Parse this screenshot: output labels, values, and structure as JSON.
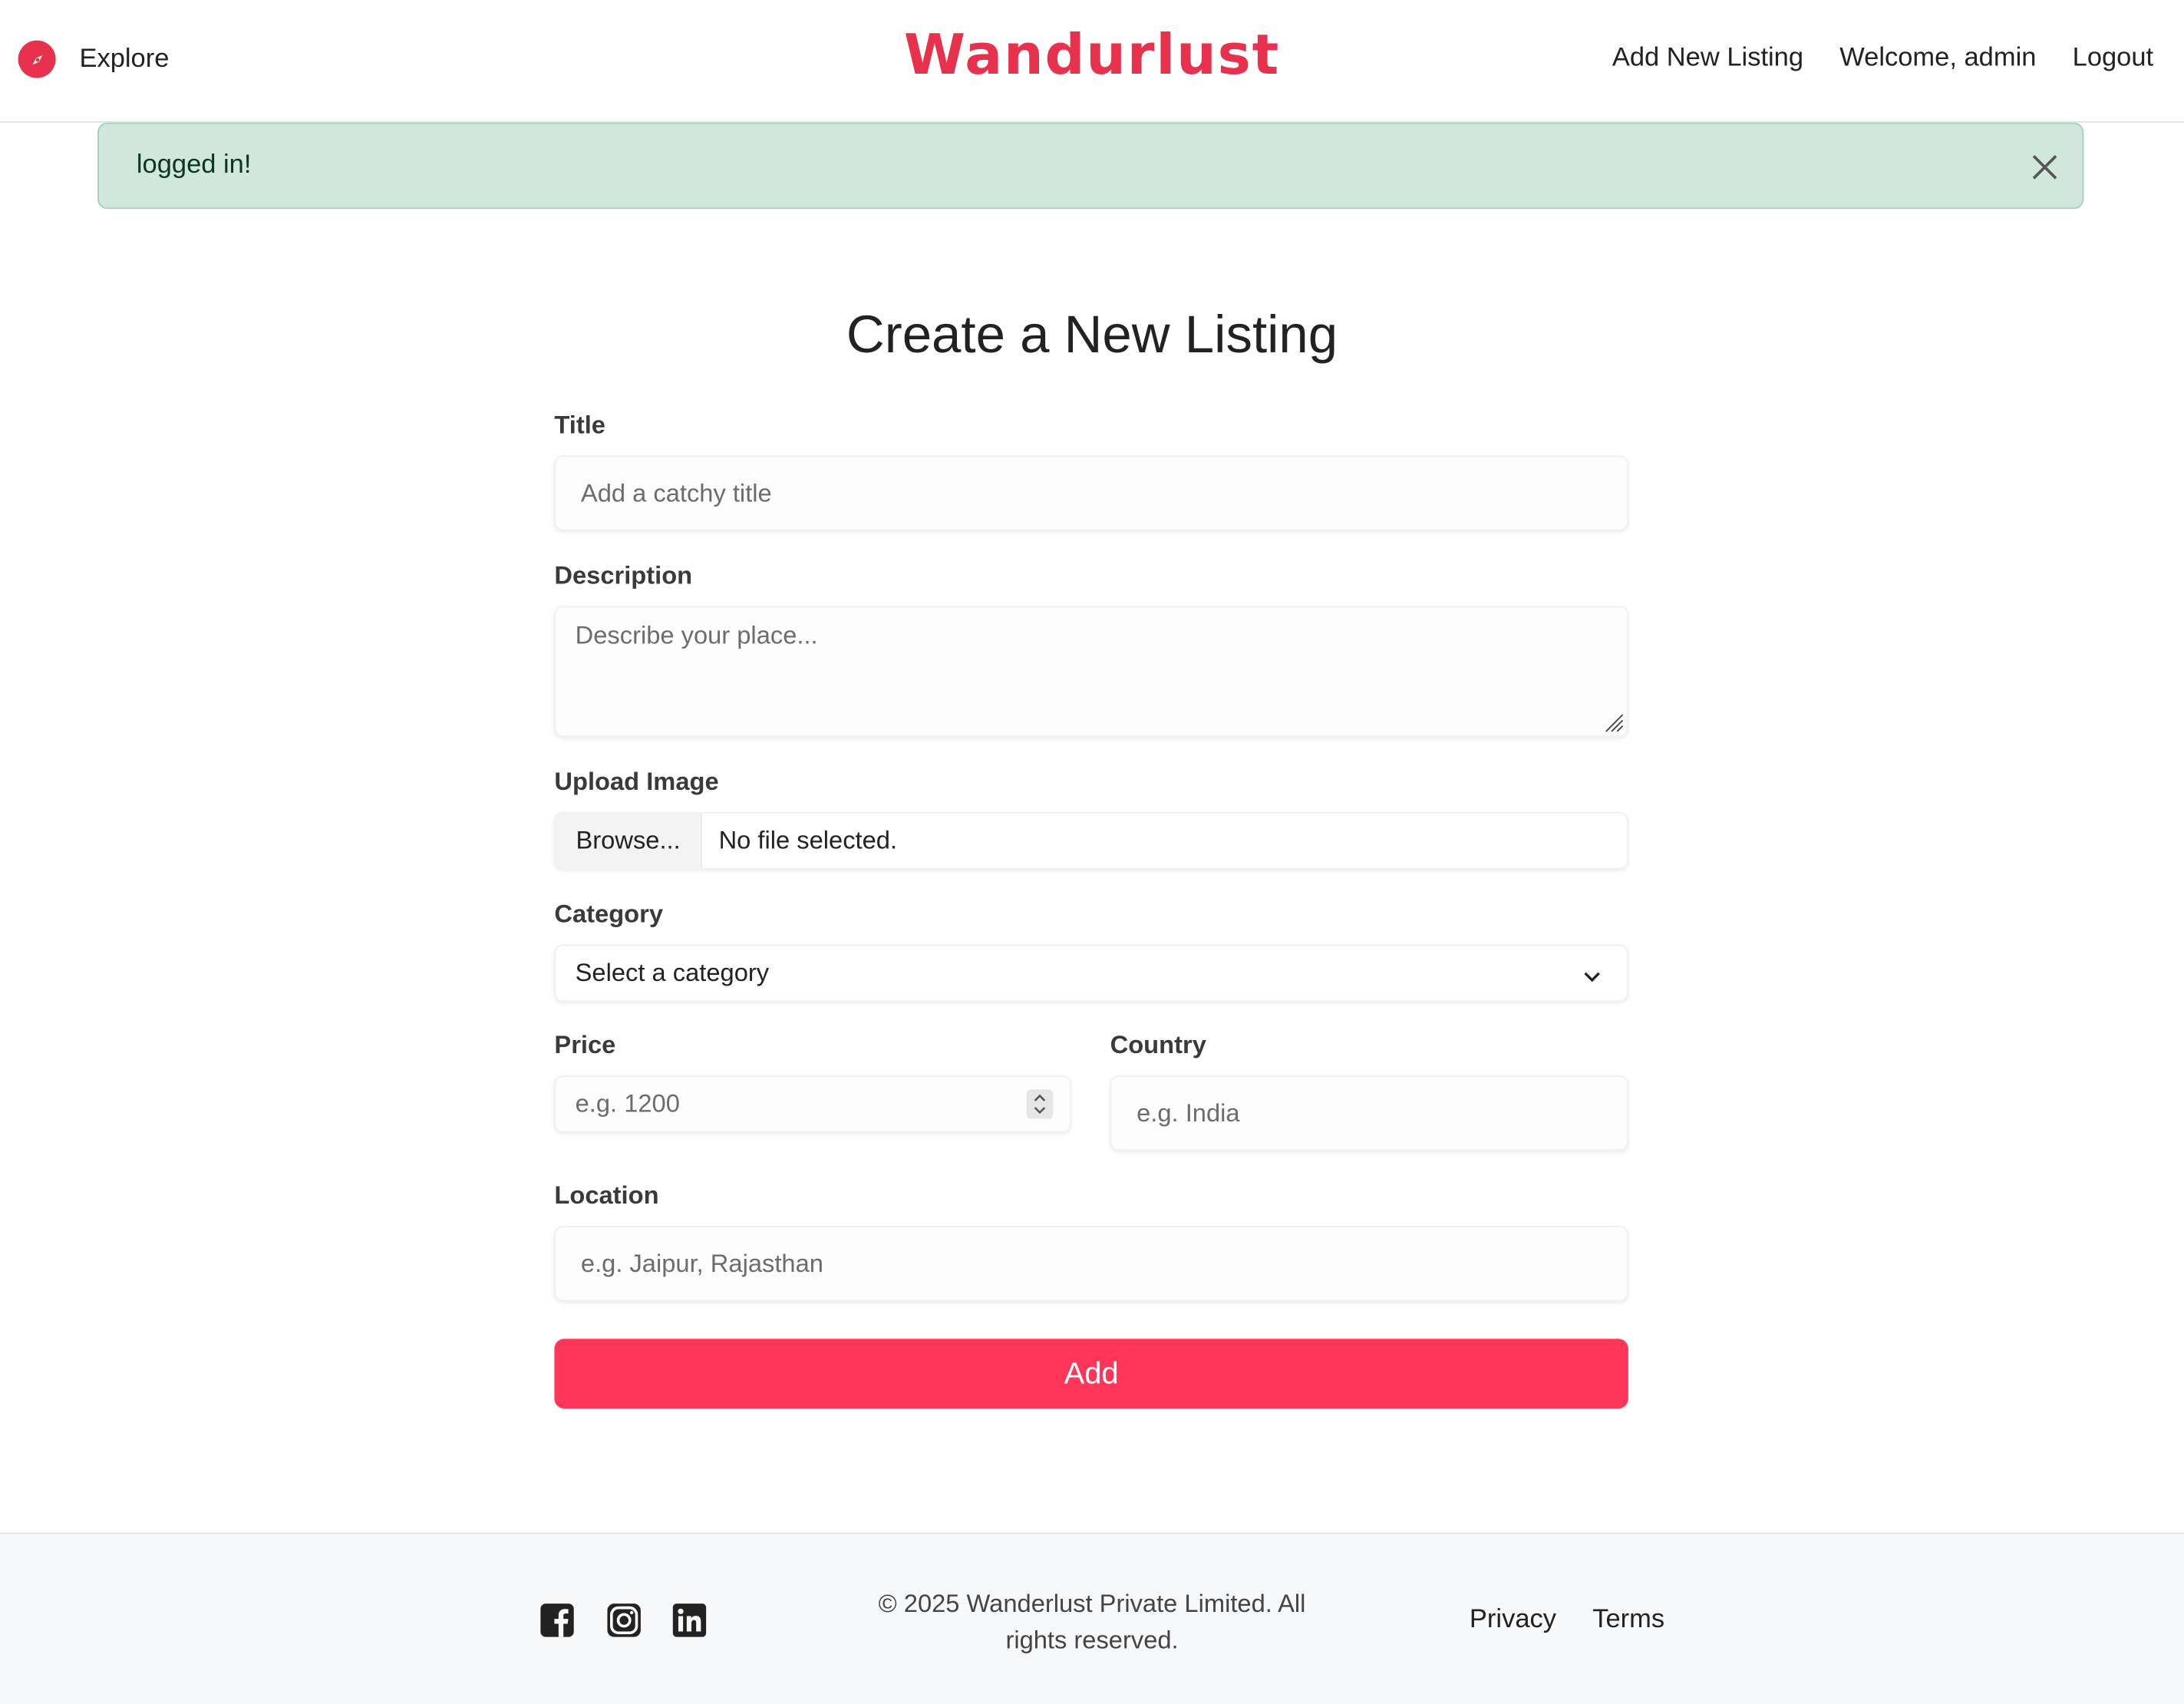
{
  "navbar": {
    "explore_label": "Explore",
    "brand": "Wandurlust",
    "add_listing_label": "Add New Listing",
    "welcome_label": "Welcome, admin",
    "logout_label": "Logout"
  },
  "alert": {
    "message": "logged in!"
  },
  "form": {
    "heading": "Create a New Listing",
    "title_label": "Title",
    "title_placeholder": "Add a catchy title",
    "description_label": "Description",
    "description_placeholder": "Describe your place...",
    "image_label": "Upload Image",
    "browse_label": "Browse...",
    "file_status": "No file selected.",
    "category_label": "Category",
    "category_selected": "Select a category",
    "price_label": "Price",
    "price_placeholder": "e.g. 1200",
    "country_label": "Country",
    "country_placeholder": "e.g. India",
    "location_label": "Location",
    "location_placeholder": "e.g. Jaipur, Rajasthan",
    "submit_label": "Add"
  },
  "footer": {
    "social_icons": [
      "facebook-icon",
      "instagram-icon",
      "linkedin-icon"
    ],
    "copyright": "© 2025 Wanderlust Private Limited. All rights reserved.",
    "privacy_label": "Privacy",
    "terms_label": "Terms"
  },
  "colors": {
    "brand": "#e8314d",
    "primary_button": "#fe375a",
    "alert_bg": "#d1e7dd",
    "footer_bg": "#f7f8fa"
  }
}
